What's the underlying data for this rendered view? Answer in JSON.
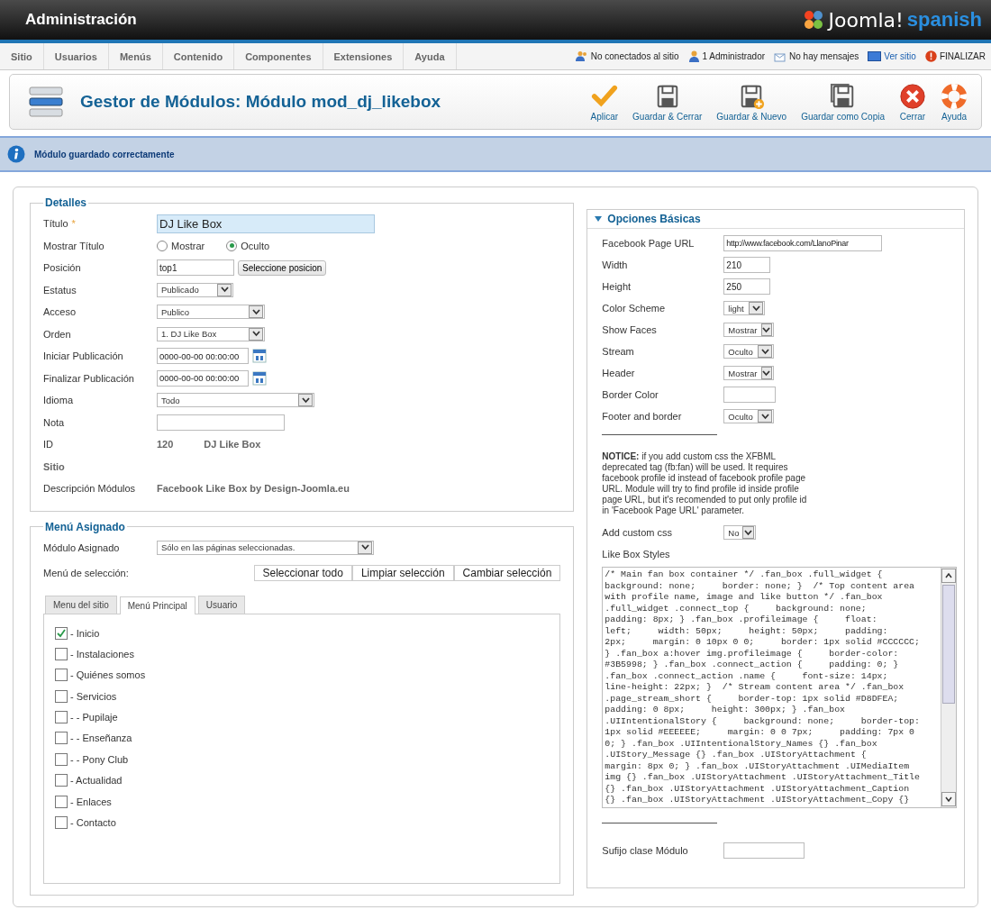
{
  "header": {
    "title": "Administración",
    "brand": "Joomla!",
    "brand_tag": "spanish"
  },
  "menu": [
    "Sitio",
    "Usuarios",
    "Menús",
    "Contenido",
    "Componentes",
    "Extensiones",
    "Ayuda"
  ],
  "status": [
    {
      "kind": "users",
      "text": "No conectados al sitio"
    },
    {
      "kind": "admin",
      "text": "1 Administrador"
    },
    {
      "kind": "mail",
      "text": "No hay mensajes"
    },
    {
      "kind": "site",
      "text": "Ver sitio"
    },
    {
      "kind": "logout",
      "text": "FINALIZAR"
    }
  ],
  "toolbar": {
    "title": "Gestor de Módulos: Módulo mod_dj_likebox",
    "buttons": [
      {
        "kind": "apply",
        "label": "Aplicar"
      },
      {
        "kind": "save",
        "label": "Guardar & Cerrar"
      },
      {
        "kind": "save_new",
        "label": "Guardar & Nuevo"
      },
      {
        "kind": "save_copy",
        "label": "Guardar como Copia"
      },
      {
        "kind": "close",
        "label": "Cerrar"
      },
      {
        "kind": "help",
        "label": "Ayuda"
      }
    ]
  },
  "message": "Módulo guardado correctamente",
  "details": {
    "legend": "Detalles",
    "fields": [
      {
        "kind": "title",
        "label": "Título",
        "required_mark": "*",
        "value": "DJ Like Box"
      },
      {
        "kind": "radio",
        "label": "Mostrar Título",
        "options": [
          {
            "label": "Mostrar",
            "selected": false
          },
          {
            "label": "Oculto",
            "selected": true
          }
        ]
      },
      {
        "kind": "text_button",
        "label": "Posición",
        "value": "top1",
        "button": "Seleccione posicion"
      },
      {
        "kind": "select",
        "label": "Estatus",
        "value": "Publicado"
      },
      {
        "kind": "select",
        "label": "Acceso",
        "value": "Publico"
      },
      {
        "kind": "select",
        "label": "Orden",
        "value": "1. DJ Like Box"
      },
      {
        "kind": "date",
        "label": "Iniciar Publicación",
        "value": "0000-00-00 00:00:00"
      },
      {
        "kind": "date",
        "label": "Finalizar Publicación",
        "value": "0000-00-00 00:00:00"
      },
      {
        "kind": "select",
        "label": "Idioma",
        "value": "Todo"
      },
      {
        "kind": "text",
        "label": "Nota"
      },
      {
        "kind": "info",
        "label": "ID",
        "values": [
          "120",
          "DJ Like Box"
        ]
      },
      {
        "kind": "note",
        "label": "Sitio"
      },
      {
        "kind": "info",
        "label": "Descripción Módulos",
        "values": [
          "Facebook Like Box by Design-Joomla.eu"
        ]
      }
    ]
  },
  "menu_assignment": {
    "legend": "Menú Asignado",
    "assigned_label": "Módulo Asignado",
    "assigned_value": "Sólo en las páginas seleccionadas.",
    "selection_label": "Menú de selección:",
    "buttons": [
      "Seleccionar todo",
      "Limpiar selección",
      "Cambiar selección"
    ],
    "tabs": [
      {
        "label": "Menu del sitio",
        "selected": false
      },
      {
        "label": "Menú Principal",
        "selected": true
      },
      {
        "label": "Usuario",
        "selected": false
      }
    ],
    "items": [
      {
        "label": "- Inicio",
        "checked": true
      },
      {
        "label": "- Instalaciones",
        "checked": false
      },
      {
        "label": "- Quiénes somos",
        "checked": false
      },
      {
        "label": "- Servicios",
        "checked": false
      },
      {
        "label": "- - Pupilaje",
        "checked": false
      },
      {
        "label": "- - Enseñanza",
        "checked": false
      },
      {
        "label": "- - Pony Club",
        "checked": false
      },
      {
        "label": "- Actualidad",
        "checked": false
      },
      {
        "label": "- Enlaces",
        "checked": false
      },
      {
        "label": "- Contacto",
        "checked": false
      }
    ]
  },
  "options": {
    "title": "Opciones Básicas",
    "expanded": true,
    "fields": [
      {
        "kind": "text",
        "label": "Facebook Page URL",
        "value": "http://www.facebook.com/LlanoPinar"
      },
      {
        "kind": "text",
        "label": "Width",
        "value": "210"
      },
      {
        "kind": "text",
        "label": "Height",
        "value": "250"
      },
      {
        "kind": "select",
        "label": "Color Scheme",
        "value": "light"
      },
      {
        "kind": "select",
        "label": "Show Faces",
        "value": "Mostrar"
      },
      {
        "kind": "select",
        "label": "Stream",
        "value": "Oculto"
      },
      {
        "kind": "select",
        "label": "Header",
        "value": "Mostrar"
      },
      {
        "kind": "text",
        "label": "Border Color"
      },
      {
        "kind": "select",
        "label": "Footer and border",
        "value": "Oculto"
      }
    ],
    "notice": "**NOTICE:** if you add custom css the XFBML deprecated tag (fb:fan) will be used. It requires facebook profile id instead of facebook profile page URL. Module will try to find profile id inside profile page URL, but it's recomended to put only profile id in 'Facebook Page URL' parameter.",
    "custom_css": {
      "label": "Add custom css",
      "value": "No"
    },
    "styles_label": "Like Box Styles",
    "styles_lines": [
      "/* Main fan box container */ .fan_box .full_widget {",
      "background: none;     border: none; }  /* Top content area",
      "with profile name, image and like button */ .fan_box",
      ".full_widget .connect_top {     background: none;",
      "padding: 8px; } .fan_box .profileimage {     float:",
      "left;     width: 50px;     height: 50px;     padding:",
      "2px;     margin: 0 10px 0 0;     border: 1px solid #CCCCCC;",
      "} .fan_box a:hover img.profileimage {     border-color:",
      "#3B5998; } .fan_box .connect_action {     padding: 0; }",
      ".fan_box .connect_action .name {     font-size: 14px;",
      "line-height: 22px; }  /* Stream content area */ .fan_box",
      ".page_stream_short {     border-top: 1px solid #D8DFEA;",
      "padding: 0 8px;     height: 300px; } .fan_box",
      ".UIIntentionalStory {     background: none;     border-top:",
      "1px solid #EEEEEE;     margin: 0 0 7px;     padding: 7px 0",
      "0; } .fan_box .UIIntentionalStory_Names {} .fan_box",
      ".UIStory_Message {} .fan_box .UIStoryAttachment {",
      "margin: 8px 0; } .fan_box .UIStoryAttachment .UIMediaItem",
      "img {} .fan_box .UIStoryAttachment .UIStoryAttachment_Title",
      "{} .fan_box .UIStoryAttachment .UIStoryAttachment_Caption",
      "{} .fan_box .UIStoryAttachment .UIStoryAttachment_Copy {}"
    ],
    "suffix_label": "Sufijo clase Módulo"
  }
}
